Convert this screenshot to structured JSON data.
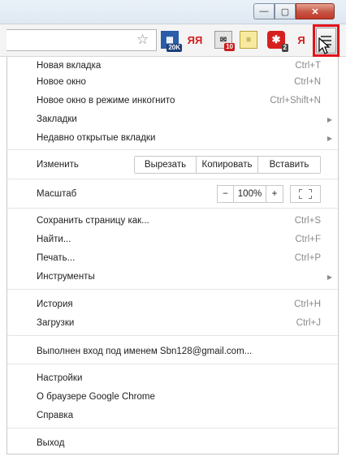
{
  "toolbar": {
    "extensions": [
      {
        "icon": "speed-dial-icon",
        "badge": "20K"
      },
      {
        "icon": "yandex-icon",
        "text": "ЯЯ"
      },
      {
        "icon": "mail-icon",
        "badge": "10"
      },
      {
        "icon": "notes-icon"
      },
      {
        "icon": "asterisk-icon",
        "badge": "2"
      },
      {
        "icon": "yandex-bar-icon",
        "text": "Я"
      }
    ],
    "window_buttons": {
      "minimize": "—",
      "maximize": "▢",
      "close": "✕"
    }
  },
  "menu": {
    "new_tab": {
      "label": "Новая вкладка",
      "shortcut": "Ctrl+T"
    },
    "new_window": {
      "label": "Новое окно",
      "shortcut": "Ctrl+N"
    },
    "incognito": {
      "label": "Новое окно в режиме инкогнито",
      "shortcut": "Ctrl+Shift+N"
    },
    "bookmarks": {
      "label": "Закладки"
    },
    "recent_tabs": {
      "label": "Недавно открытые вкладки"
    },
    "edit": {
      "label": "Изменить",
      "cut": "Вырезать",
      "copy": "Копировать",
      "paste": "Вставить"
    },
    "zoom": {
      "label": "Масштаб",
      "minus": "−",
      "value": "100%",
      "plus": "+"
    },
    "save_page": {
      "label": "Сохранить страницу как...",
      "shortcut": "Ctrl+S"
    },
    "find": {
      "label": "Найти...",
      "shortcut": "Ctrl+F"
    },
    "print": {
      "label": "Печать...",
      "shortcut": "Ctrl+P"
    },
    "tools": {
      "label": "Инструменты"
    },
    "history": {
      "label": "История",
      "shortcut": "Ctrl+H"
    },
    "downloads": {
      "label": "Загрузки",
      "shortcut": "Ctrl+J"
    },
    "signed_in": {
      "label": "Выполнен вход под именем Sbn128@gmail.com..."
    },
    "settings": {
      "label": "Настройки"
    },
    "about": {
      "label": "О браузере Google Chrome"
    },
    "help": {
      "label": "Справка"
    },
    "exit": {
      "label": "Выход"
    }
  },
  "colors": {
    "highlight": "#e3141c"
  }
}
